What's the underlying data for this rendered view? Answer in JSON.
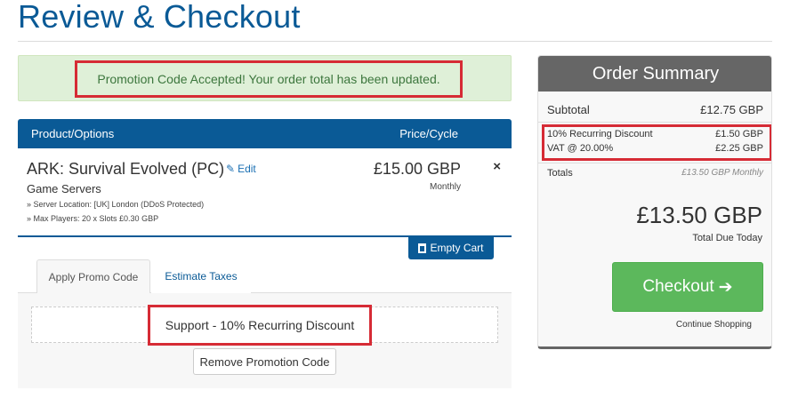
{
  "page": {
    "title": "Review & Checkout"
  },
  "alert": {
    "message": "Promotion Code Accepted! Your order total has been updated."
  },
  "cart": {
    "headers": {
      "product": "Product/Options",
      "price": "Price/Cycle"
    },
    "item": {
      "name": "ARK: Survival Evolved (PC)",
      "edit_label": "Edit",
      "group": "Game Servers",
      "options": [
        "» Server Location: [UK] London (DDoS Protected)",
        "» Max Players: 20 x Slots £0.30 GBP"
      ],
      "price": "£15.00 GBP",
      "cycle": "Monthly",
      "remove_glyph": "×"
    },
    "empty_cart_label": "Empty Cart"
  },
  "tabs": [
    {
      "label": "Apply Promo Code"
    },
    {
      "label": "Estimate Taxes"
    }
  ],
  "promo": {
    "code_text": "Support - 10% Recurring Discount",
    "remove_label": "Remove Promotion Code"
  },
  "summary": {
    "title": "Order Summary",
    "subtotal_label": "Subtotal",
    "subtotal_value": "£12.75 GBP",
    "discount_label": "10% Recurring Discount",
    "discount_value": "£1.50 GBP",
    "vat_label": "VAT @ 20.00%",
    "vat_value": "£2.25 GBP",
    "totals_label": "Totals",
    "totals_value": "£13.50 GBP Monthly",
    "total_due": "£13.50 GBP",
    "total_due_label": "Total Due Today",
    "checkout_label": "Checkout",
    "continue_label": "Continue Shopping"
  },
  "colors": {
    "brand_blue": "#0a5a96",
    "success_green": "#5cb85c",
    "alert_bg": "#dff0d8",
    "highlight_red": "#d62b35",
    "summary_grey": "#666666"
  }
}
